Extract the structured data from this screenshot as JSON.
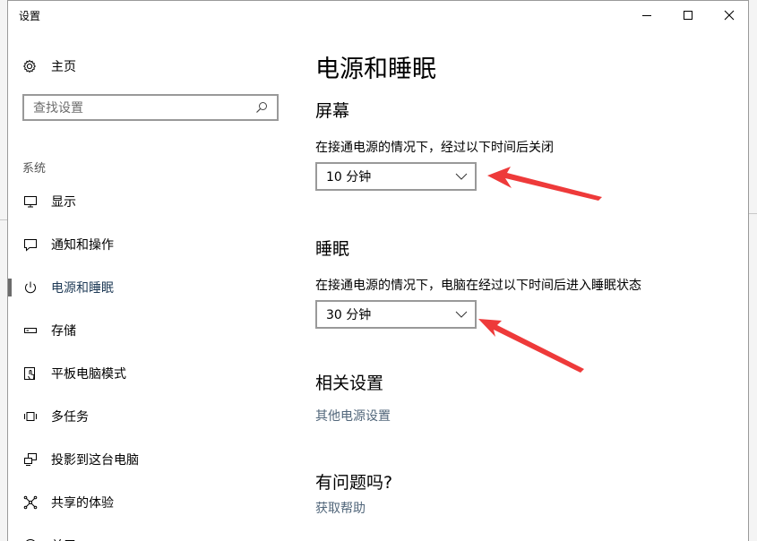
{
  "window": {
    "title": "设置"
  },
  "sidebar": {
    "home_label": "主页",
    "search_placeholder": "查找设置",
    "section_label": "系统",
    "items": [
      {
        "label": "显示",
        "icon": "monitor-icon"
      },
      {
        "label": "通知和操作",
        "icon": "notification-icon"
      },
      {
        "label": "电源和睡眠",
        "icon": "power-icon",
        "active": true
      },
      {
        "label": "存储",
        "icon": "storage-icon"
      },
      {
        "label": "平板电脑模式",
        "icon": "tablet-mode-icon"
      },
      {
        "label": "多任务",
        "icon": "multitasking-icon"
      },
      {
        "label": "投影到这台电脑",
        "icon": "projecting-icon"
      },
      {
        "label": "共享的体验",
        "icon": "shared-experiences-icon"
      },
      {
        "label": "关于",
        "icon": "about-icon"
      }
    ]
  },
  "main": {
    "title": "电源和睡眠",
    "screen": {
      "heading": "屏幕",
      "description": "在接通电源的情况下，经过以下时间后关闭",
      "value": "10 分钟"
    },
    "sleep": {
      "heading": "睡眠",
      "description": "在接通电源的情况下，电脑在经过以下时间后进入睡眠状态",
      "value": "30 分钟"
    },
    "related": {
      "heading": "相关设置",
      "link": "其他电源设置"
    },
    "help": {
      "heading": "有问题吗?",
      "link": "获取帮助"
    }
  },
  "colors": {
    "link": "#52677b",
    "annotation_arrow": "#ee3a3a",
    "active_bar": "#6b6b6b"
  }
}
